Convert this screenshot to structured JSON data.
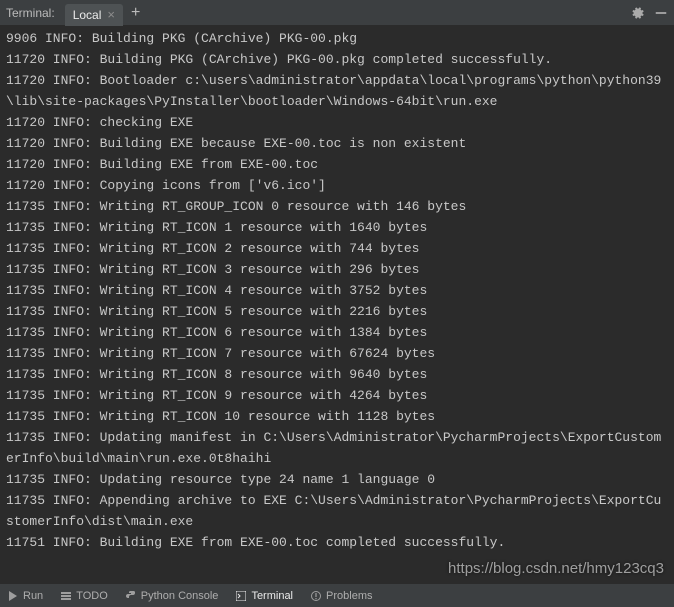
{
  "header": {
    "title": "Terminal:",
    "tab_label": "Local"
  },
  "terminal": {
    "lines": "9906 INFO: Building PKG (CArchive) PKG-00.pkg\n11720 INFO: Building PKG (CArchive) PKG-00.pkg completed successfully.\n11720 INFO: Bootloader c:\\users\\administrator\\appdata\\local\\programs\\python\\python39\\lib\\site-packages\\PyInstaller\\bootloader\\Windows-64bit\\run.exe\n11720 INFO: checking EXE\n11720 INFO: Building EXE because EXE-00.toc is non existent\n11720 INFO: Building EXE from EXE-00.toc\n11720 INFO: Copying icons from ['v6.ico']\n11735 INFO: Writing RT_GROUP_ICON 0 resource with 146 bytes\n11735 INFO: Writing RT_ICON 1 resource with 1640 bytes\n11735 INFO: Writing RT_ICON 2 resource with 744 bytes\n11735 INFO: Writing RT_ICON 3 resource with 296 bytes\n11735 INFO: Writing RT_ICON 4 resource with 3752 bytes\n11735 INFO: Writing RT_ICON 5 resource with 2216 bytes\n11735 INFO: Writing RT_ICON 6 resource with 1384 bytes\n11735 INFO: Writing RT_ICON 7 resource with 67624 bytes\n11735 INFO: Writing RT_ICON 8 resource with 9640 bytes\n11735 INFO: Writing RT_ICON 9 resource with 4264 bytes\n11735 INFO: Writing RT_ICON 10 resource with 1128 bytes\n11735 INFO: Updating manifest in C:\\Users\\Administrator\\PycharmProjects\\ExportCustomerInfo\\build\\main\\run.exe.0t8haihi\n11735 INFO: Updating resource type 24 name 1 language 0\n11735 INFO: Appending archive to EXE C:\\Users\\Administrator\\PycharmProjects\\ExportCustomerInfo\\dist\\main.exe\n11751 INFO: Building EXE from EXE-00.toc completed successfully.\n"
  },
  "bottom": {
    "run": "Run",
    "todo": "TODO",
    "python_console": "Python Console",
    "terminal": "Terminal",
    "problems": "Problems"
  },
  "watermark": "https://blog.csdn.net/hmy123cq3"
}
